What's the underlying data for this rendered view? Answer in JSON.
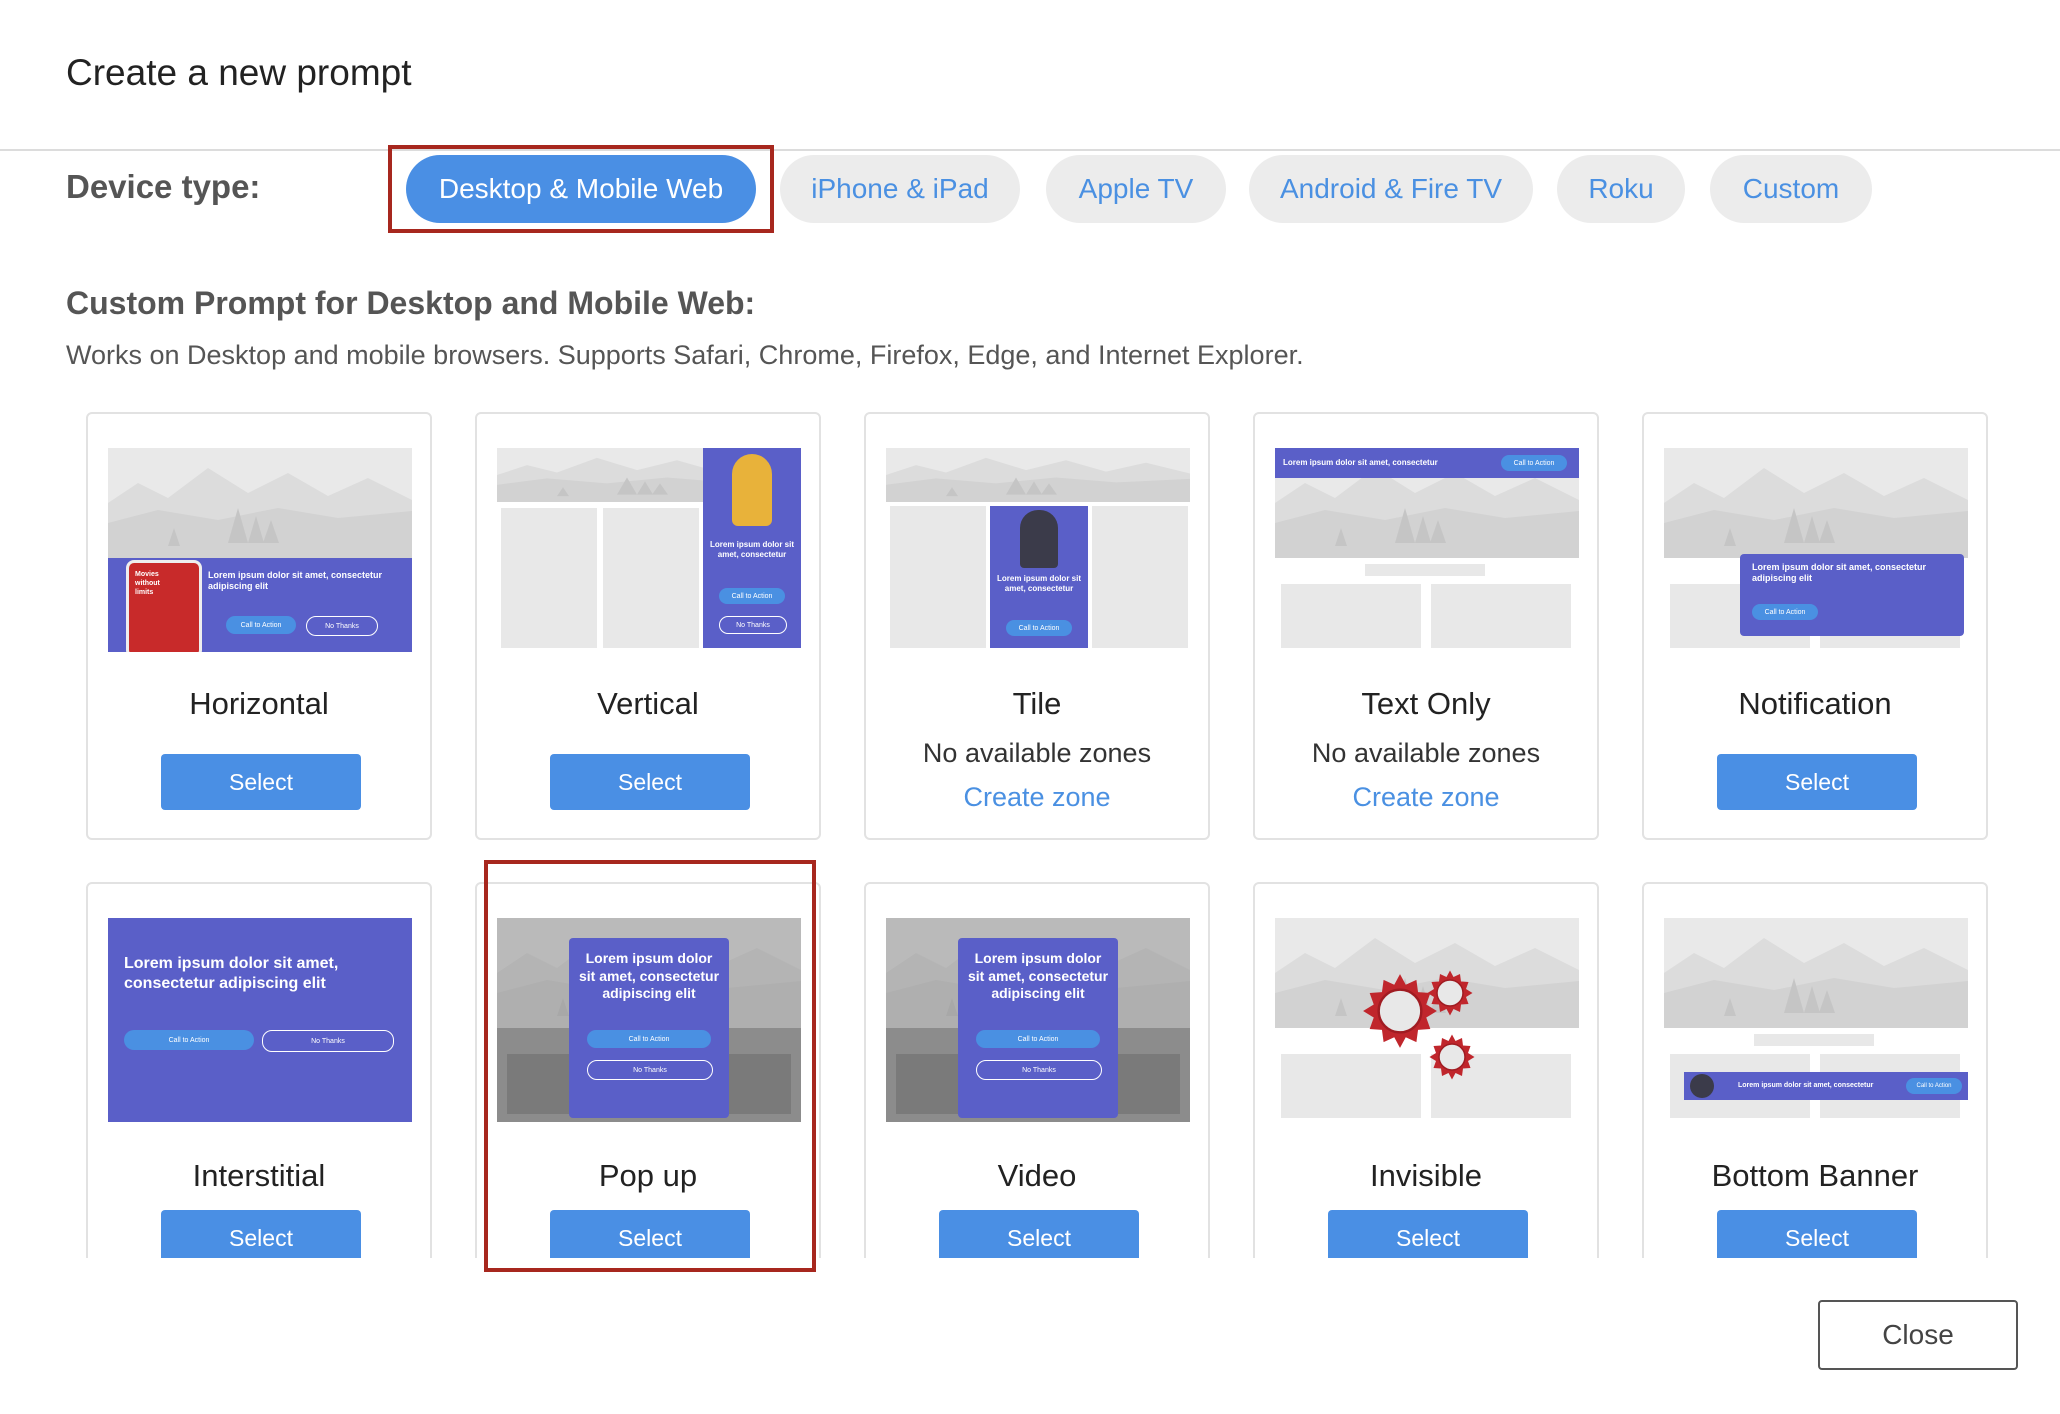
{
  "header": {
    "title": "Create a new prompt"
  },
  "device_type": {
    "label": "Device type:",
    "options": [
      {
        "label": "Desktop & Mobile Web",
        "active": true
      },
      {
        "label": "iPhone & iPad",
        "active": false
      },
      {
        "label": "Apple TV",
        "active": false
      },
      {
        "label": "Android & Fire TV",
        "active": false
      },
      {
        "label": "Roku",
        "active": false
      },
      {
        "label": "Custom",
        "active": false
      }
    ]
  },
  "section": {
    "heading": "Custom Prompt for Desktop and Mobile Web:",
    "description": "Works on Desktop and mobile browsers. Supports Safari, Chrome, Firefox, Edge, and Internet Explorer."
  },
  "cards": [
    {
      "title": "Horizontal",
      "action": "Select"
    },
    {
      "title": "Vertical",
      "action": "Select"
    },
    {
      "title": "Tile",
      "note": "No available zones",
      "link": "Create zone"
    },
    {
      "title": "Text Only",
      "note": "No available zones",
      "link": "Create zone"
    },
    {
      "title": "Notification",
      "action": "Select"
    },
    {
      "title": "Interstitial",
      "action": "Select"
    },
    {
      "title": "Pop up",
      "action": "Select"
    },
    {
      "title": "Video",
      "action": "Select"
    },
    {
      "title": "Invisible",
      "action": "Select"
    },
    {
      "title": "Bottom Banner",
      "action": "Select"
    }
  ],
  "preview_text": {
    "lorem_short": "Lorem ipsum dolor sit amet, consectetur",
    "lorem_long": "Lorem ipsum dolor sit amet, consectetur adipiscing elit",
    "lorem_vertical": "Lorem ipsum dolor sit amet, consectetur",
    "lorem_tile": "Lorem ipsum dolor sit amet, consectetur",
    "popup": "Lorem ipsum dolor sit amet, consectetur adipiscing elit",
    "cta": "Call to Action",
    "no_thanks": "No Thanks",
    "phone_text": "Movies without limits"
  },
  "footer": {
    "close_label": "Close"
  },
  "colors": {
    "accent": "#4a8fe4",
    "highlight": "#a7271e",
    "promo_purple": "#5a5fc8"
  }
}
